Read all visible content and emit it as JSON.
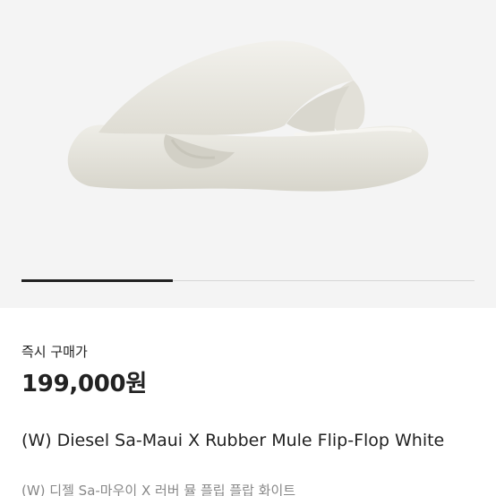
{
  "product": {
    "image_alt": "sandal-image",
    "instant_buy_label": "즉시 구매가",
    "price": "199,000원",
    "title": "(W) Diesel Sa-Maui X Rubber Mule Flip-Flop White",
    "subtitle": "(W) 디젤 Sa-마우이 X 러버 뮬 플립 플랍 화이트"
  },
  "carousel": {
    "current_index": 1,
    "total": 3
  },
  "colors": {
    "hero_background": "#f4f4f4",
    "sandal": "#ecebe4",
    "text_primary": "#222222",
    "text_secondary": "#888888"
  }
}
